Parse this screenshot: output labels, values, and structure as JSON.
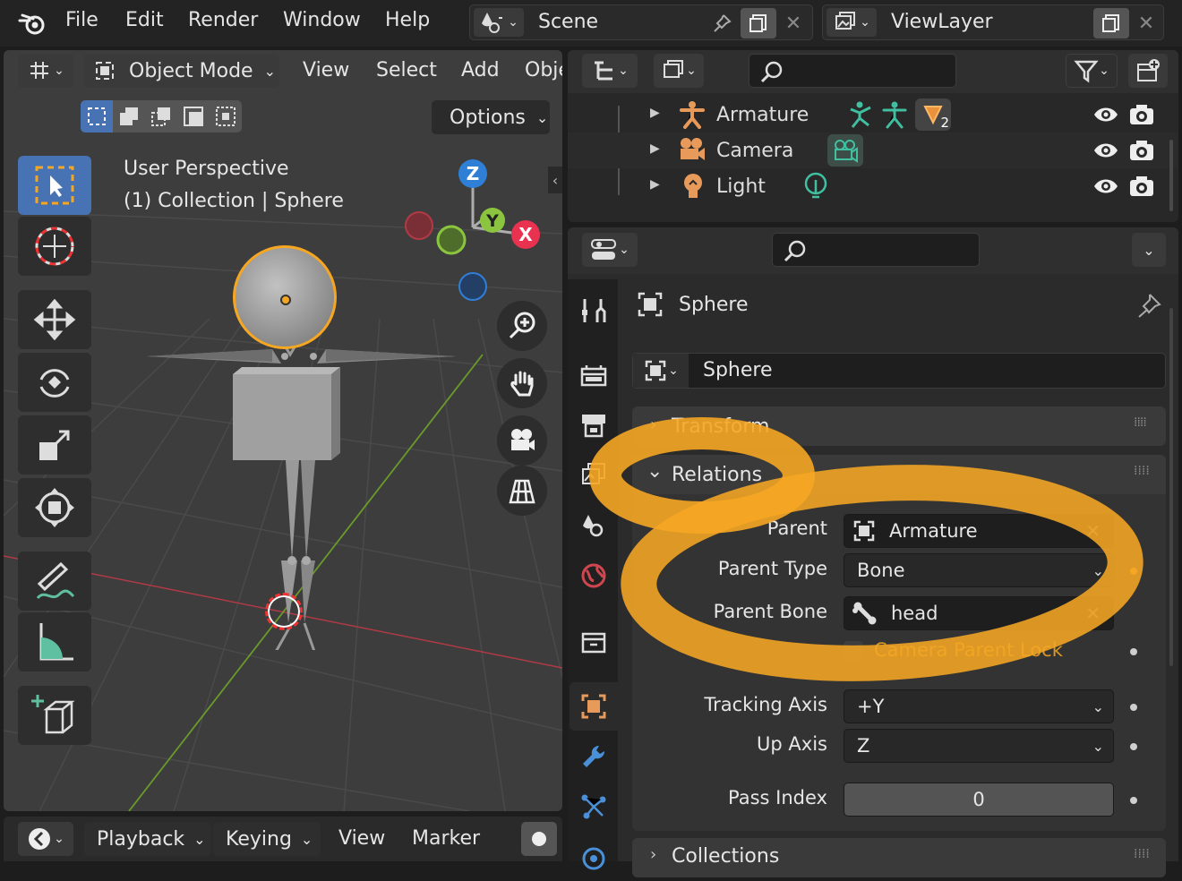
{
  "topbar": {
    "menus": [
      "File",
      "Edit",
      "Render",
      "Window",
      "Help"
    ],
    "scene": "Scene",
    "viewlayer": "ViewLayer"
  },
  "viewport": {
    "mode": "Object Mode",
    "menus": [
      "View",
      "Select",
      "Add",
      "Obje"
    ],
    "options": "Options",
    "perspective": "User Perspective",
    "collection": "(1) Collection | Sphere",
    "gizmo": {
      "z": "Z",
      "y": "Y",
      "x": "X"
    }
  },
  "outliner": {
    "rows": [
      {
        "label": "Armature",
        "badge": "2"
      },
      {
        "label": "Camera"
      },
      {
        "label": "Light"
      }
    ]
  },
  "properties": {
    "object_name": "Sphere",
    "name_field": "Sphere",
    "panels": {
      "transform": "Transform",
      "relations": "Relations",
      "collections": "Collections"
    },
    "relations": {
      "parent_label": "Parent",
      "parent_value": "Armature",
      "parent_type_label": "Parent Type",
      "parent_type_value": "Bone",
      "parent_bone_label": "Parent Bone",
      "parent_bone_value": "head",
      "camera_lock_label": "Camera Parent Lock",
      "tracking_label": "Tracking Axis",
      "tracking_value": "+Y",
      "up_label": "Up Axis",
      "up_value": "Z",
      "pass_label": "Pass Index",
      "pass_value": "0"
    }
  },
  "timeline": {
    "menus": [
      "Playback",
      "Keying",
      "View",
      "Marker"
    ]
  },
  "colors": {
    "accent": "#f5a623",
    "x_axis": "#e8324f",
    "y_axis": "#8bc53f",
    "z_axis": "#2f7fd6",
    "highlight": "#4772b3"
  }
}
